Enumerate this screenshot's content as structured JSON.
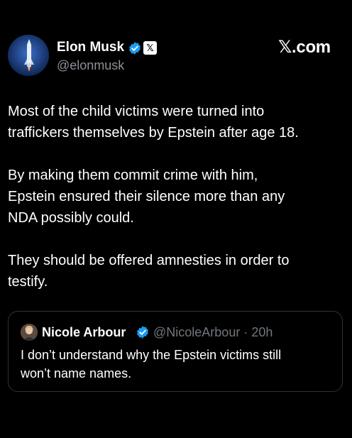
{
  "colors": {
    "background": "#000000",
    "primary_text": "#ffffff",
    "secondary_text": "#71767b",
    "verified_blue": "#1d9bf0",
    "border": "#2f3336"
  },
  "author": {
    "name": "Elon Musk",
    "handle": "@elonmusk",
    "avatar_icon": "rocket-avatar",
    "verified_icon": "verified-badge-icon",
    "affiliate_icon": "x-affiliate-badge-icon",
    "affiliate_label": "𝕏"
  },
  "watermark": "𝕏.com",
  "tweet": {
    "paragraphs": [
      "Most of the child victims were turned into\ntraffickers themselves by Epstein after age 18.",
      "By making them commit crime with him,\nEpstein ensured their silence more than any\nNDA possibly could.",
      "They should be offered amnesties in order to\ntestify."
    ]
  },
  "quote": {
    "name": "Nicole Arbour",
    "handle": "@NicoleArbour",
    "separator": "·",
    "time": "20h",
    "text": "I don’t understand why the Epstein victims still\nwon’t name names.",
    "avatar_icon": "user-avatar",
    "verified_icon": "verified-badge-icon"
  }
}
